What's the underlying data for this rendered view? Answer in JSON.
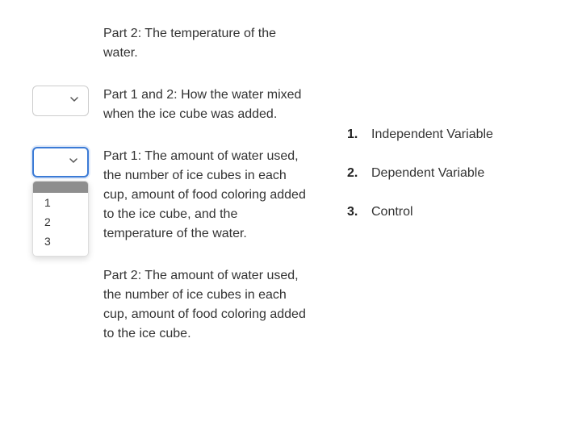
{
  "left": {
    "item1_text": "Part 2: The temperature of the water.",
    "item2_text": "Part 1 and 2: How the water mixed when the ice cube was added.",
    "item3_text": "Part 1: The amount of water used, the number of ice cubes in each cup, amount of food coloring added to the ice cube, and the temperature of the water.",
    "item4_text": "Part 2: The amount of water used, the number of ice cubes in each cup, amount of food coloring added to the ice cube."
  },
  "dropdown": {
    "options": [
      "1",
      "2",
      "3"
    ]
  },
  "key": {
    "items": [
      {
        "num": "1.",
        "label": "Independent Variable"
      },
      {
        "num": "2.",
        "label": "Dependent Variable"
      },
      {
        "num": "3.",
        "label": "Control"
      }
    ]
  }
}
